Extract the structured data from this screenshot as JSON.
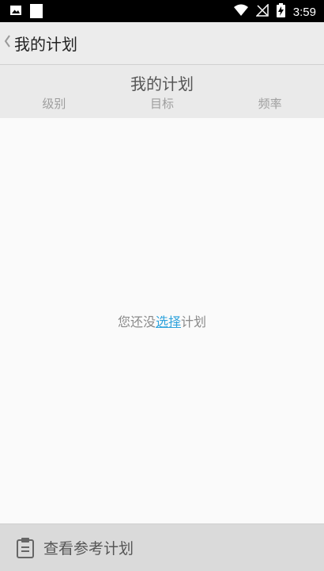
{
  "status_bar": {
    "time": "3:59",
    "icons": [
      "image-icon",
      "square-icon",
      "wifi-icon",
      "no-signal-icon",
      "battery-charging-icon"
    ]
  },
  "app_bar": {
    "back_icon": "chevron-left-icon",
    "title": "我的计划"
  },
  "plan_header": {
    "title": "我的计划",
    "columns": [
      "级别",
      "目标",
      "频率"
    ]
  },
  "empty_state": {
    "prefix": "您还没",
    "link": "选择",
    "suffix": "计划"
  },
  "bottom_bar": {
    "icon": "clipboard-icon",
    "label": "查看参考计划"
  },
  "colors": {
    "accent_link": "#2fa3dc",
    "status_bar_bg": "#000000"
  }
}
